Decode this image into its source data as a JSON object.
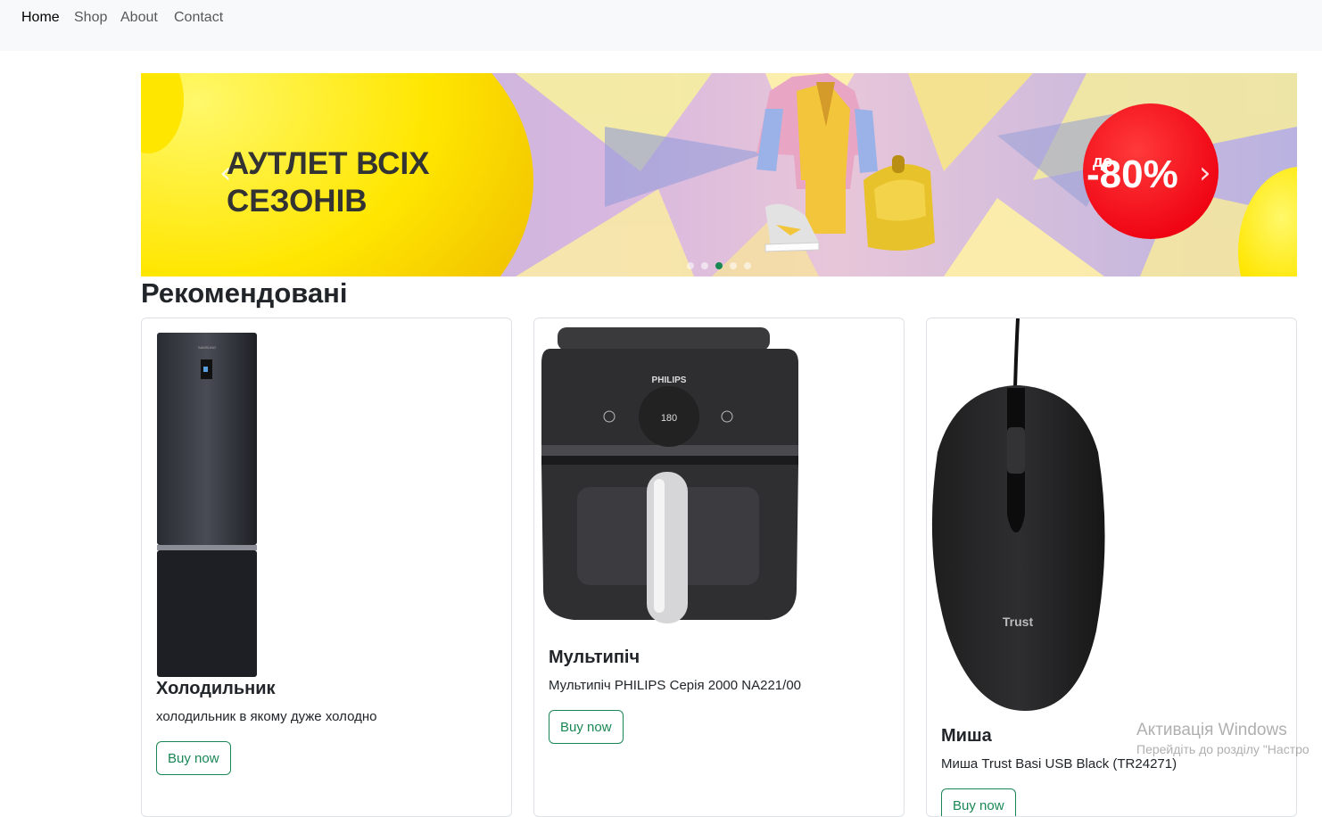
{
  "nav": {
    "items": [
      {
        "label": "Home",
        "active": true
      },
      {
        "label": "Shop",
        "active": false
      },
      {
        "label": "About",
        "active": false
      },
      {
        "label": "Contact",
        "active": false
      }
    ]
  },
  "banner": {
    "headline_line1": "АУТЛЕТ ВСІХ",
    "headline_line2": "СЕЗОНІВ",
    "discount_prefix": "до",
    "discount_value": "-80%",
    "prev_icon": "chevron-left-icon",
    "next_icon": "chevron-right-icon",
    "indicator_count": 5,
    "active_indicator": 2,
    "colors": {
      "yellow": "#ffe600",
      "red": "#ff0a1e",
      "accent": "#198754"
    }
  },
  "section": {
    "title": "Рекомендовані"
  },
  "products": [
    {
      "title": "Холодильник",
      "description": "холодильник в якому дуже холодно",
      "button": "Buy now"
    },
    {
      "title": "Мультипіч",
      "description": "Мультипіч PHILIPS Серія 2000 NA221/00",
      "button": "Buy now"
    },
    {
      "title": "Миша",
      "description": "Миша Trust Basi USB Black (TR24271)",
      "button": "Buy now"
    }
  ],
  "product_images": {
    "fridge_brand": "SAMSUNG",
    "airfryer_brand": "PHILIPS",
    "airfryer_display": "180",
    "mouse_brand": "Trust"
  },
  "os_watermark": {
    "title": "Активація Windows",
    "subtitle": "Перейдіть до розділу \"Настро"
  }
}
